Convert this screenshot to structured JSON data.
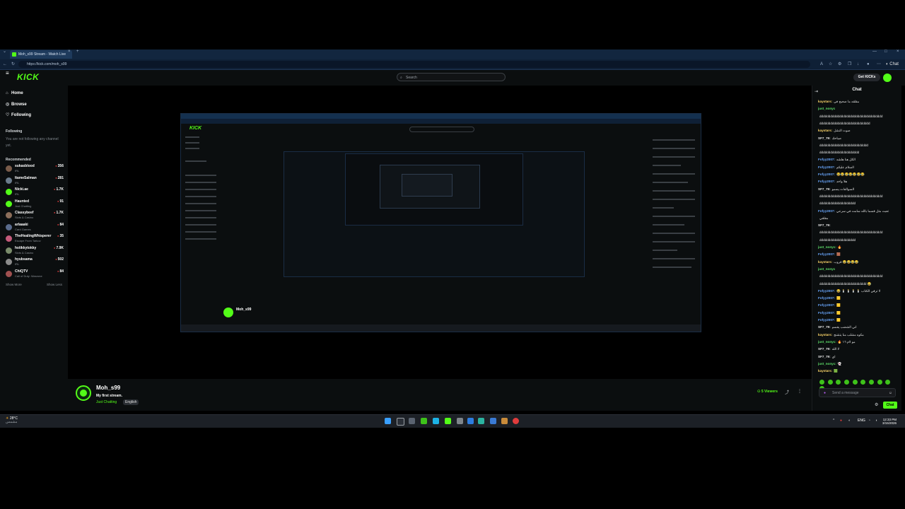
{
  "browser": {
    "tab_title": "Moh_s99 Stream - Watch Live",
    "url": "https://kick.com/moh_s99",
    "chat_toggle_label": "Chat"
  },
  "header": {
    "logo": "KICK",
    "search_placeholder": "Search",
    "get_kicks_label": "Get KICKs"
  },
  "sidebar": {
    "nav": [
      {
        "label": "Home",
        "icon": "home-icon"
      },
      {
        "label": "Browse",
        "icon": "compass-icon"
      },
      {
        "label": "Following",
        "icon": "heart-icon"
      }
    ],
    "following_title": "Following",
    "following_empty": "You are not following any channel yet.",
    "recommended_title": "Recommended",
    "recommended": [
      {
        "name": "sukasblood",
        "category": "IRL",
        "viewers": "356",
        "color": "#7a5c4a"
      },
      {
        "name": "ItameSalman",
        "category": "IRL",
        "viewers": "281",
        "color": "#6b7c8c"
      },
      {
        "name": "Nicki.ae",
        "category": "IRL",
        "viewers": "1.7K",
        "color": "#53fc18"
      },
      {
        "name": "Haunted",
        "category": "Just Chatting",
        "viewers": "91",
        "color": "#53fc18"
      },
      {
        "name": "Classybeef",
        "category": "Slots & Casino",
        "viewers": "1.7K",
        "color": "#8c6e5a"
      },
      {
        "name": "arlaaaki",
        "category": "Card Games",
        "viewers": "84",
        "color": "#5a6b8c"
      },
      {
        "name": "TheHealingWhisperer",
        "category": "Escape From Tarkov",
        "viewers": "35",
        "color": "#c45a7a"
      },
      {
        "name": "hstikkytokky",
        "category": "Slots & Casino",
        "viewers": "7.9K",
        "color": "#7a8c6b"
      },
      {
        "name": "hyubsama",
        "category": "IRL",
        "viewers": "502",
        "color": "#8c8c8c"
      },
      {
        "name": "ChiQTV",
        "category": "Call of Duty: Warzone",
        "viewers": "84",
        "color": "#a05050"
      }
    ],
    "show_more": "Show More",
    "show_less": "Show Less"
  },
  "channel": {
    "name": "Moh_s99",
    "title": "My first stream.",
    "category": "Just Chatting",
    "tag": "English",
    "viewers": "5 Viewers"
  },
  "chat": {
    "title": "Chat",
    "input_placeholder": "Send a message",
    "send_label": "Chat",
    "messages": [
      {
        "user": "kaystars:",
        "text": "مقلقه ما صحيح في",
        "color": "#ffd86a"
      },
      {
        "user": "just_nonyc",
        "text": "",
        "color": "#5fe06a"
      },
      {
        "user": "",
        "text": "ddddddddddddddddddddddddddddddddddd",
        "color": "#cfd3d6"
      },
      {
        "user": "",
        "text": "dddddddddddddddddddddddddddd",
        "color": "#cfd3d6"
      },
      {
        "user": "kaystars:",
        "text": "صوت النشل",
        "color": "#ffd86a"
      },
      {
        "user": "SF7_79:",
        "text": "صباحك",
        "color": "#e8e8e8"
      },
      {
        "user": "",
        "text": "ddddddddddddddddddddddddddd",
        "color": "#cfd3d6"
      },
      {
        "user": "",
        "text": "dddddddddddddddddddddd",
        "color": "#cfd3d6"
      },
      {
        "user": "Fofyy2007:",
        "text": "الكل هنا هلشه",
        "color": "#6aa8ff"
      },
      {
        "user": "Fofyy2007:",
        "text": "السلام عليكم",
        "color": "#6aa8ff"
      },
      {
        "user": "Fofyy2007:",
        "text": "😂😂😂😂😂😂😂",
        "color": "#6aa8ff"
      },
      {
        "user": "Fofyy2007:",
        "text": "هلا واحد",
        "color": "#6aa8ff"
      },
      {
        "user": "SF7_79:",
        "text": "السوالفات يسمو",
        "color": "#e8e8e8"
      },
      {
        "user": "",
        "text": "ddddddddddddddddddddddddddddddddddd",
        "color": "#cfd3d6"
      },
      {
        "user": "",
        "text": "dddddddddddddddddddd",
        "color": "#cfd3d6"
      },
      {
        "user": "Fofyy2007:",
        "text": "تعبت مثل قسما بالله سامت في سرعي",
        "color": "#6aa8ff"
      },
      {
        "user": "",
        "text": "مقلقي",
        "color": "#cfd3d6"
      },
      {
        "user": "SF7_79:",
        "text": "",
        "color": "#e8e8e8"
      },
      {
        "user": "",
        "text": "ddddddddddddddddddddddddddddddddddd",
        "color": "#cfd3d6"
      },
      {
        "user": "",
        "text": "dddddddddddddddddddd",
        "color": "#cfd3d6"
      },
      {
        "user": "just_nonyc:",
        "text": "🔥",
        "color": "#5fe06a"
      },
      {
        "user": "Fofyy2007:",
        "text": "🟫",
        "color": "#6aa8ff"
      },
      {
        "user": "kaystars:",
        "text": "قروب 😂😂😂😂",
        "color": "#ffd86a"
      },
      {
        "user": "just_nonyc",
        "text": "",
        "color": "#5fe06a"
      },
      {
        "user": "",
        "text": "ddddddddddddddddddddddddddddddddddd",
        "color": "#cfd3d6"
      },
      {
        "user": "",
        "text": "dddddddddddddddddddddddddd 😂",
        "color": "#cfd3d6"
      },
      {
        "user": "Fofyy2007:",
        "text": "😂 🕯️ 🕯️ 🕯️ 🕯️ لا ترقي الكتاب",
        "color": "#6aa8ff"
      },
      {
        "user": "Fofyy2007:",
        "text": "🟨",
        "color": "#6aa8ff"
      },
      {
        "user": "Fofyy2007:",
        "text": "🟨",
        "color": "#6aa8ff"
      },
      {
        "user": "Fofyy2007:",
        "text": "🟨",
        "color": "#6aa8ff"
      },
      {
        "user": "Fofyy2007:",
        "text": "🟨",
        "color": "#6aa8ff"
      },
      {
        "user": "SF7_79:",
        "text": "اني الشضب يقسم",
        "color": "#e8e8e8"
      },
      {
        "user": "kaystars:",
        "text": "مكوه مشلب منا يتشنج",
        "color": "#ffd86a"
      },
      {
        "user": "just_nonyc:",
        "text": "🔥 مو لام ١٦",
        "color": "#5fe06a"
      },
      {
        "user": "SF7_79:",
        "text": "لا الله",
        "color": "#e8e8e8"
      },
      {
        "user": "SF7_79:",
        "text": "اي",
        "color": "#e8e8e8"
      },
      {
        "user": "just_nonyc:",
        "text": "👻",
        "color": "#5fe06a"
      },
      {
        "user": "kaystars:",
        "text": "🟩",
        "color": "#ffd86a"
      }
    ]
  },
  "taskbar": {
    "weather_temp": "28°C",
    "weather_desc": "مشمس",
    "time": "12:33 PM",
    "date": "3/15/2026",
    "lang": "ENG"
  }
}
